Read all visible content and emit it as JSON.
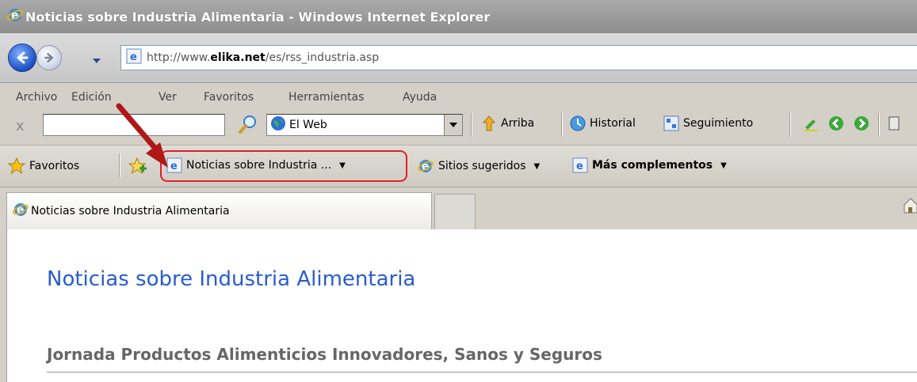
{
  "window": {
    "title": "Noticias sobre Industria Alimentaria - Windows Internet Explorer"
  },
  "address": {
    "url_prefix": "http://www.",
    "url_domain": "elika.net",
    "url_suffix": "/es/rss_industria.asp"
  },
  "menu": {
    "items": [
      "Archivo",
      "Edición",
      "Ver",
      "Favoritos",
      "Herramientas",
      "Ayuda"
    ]
  },
  "toolbar": {
    "close_label": "x",
    "search_value": "",
    "search_engine": "El Web",
    "arriba": "Arriba",
    "historial": "Historial",
    "seguimiento": "Seguimiento"
  },
  "favorites_bar": {
    "favoritos": "Favoritos",
    "feed_item": "Noticias sobre Industria ...",
    "sitios": "Sitios sugeridos",
    "complementos": "Más complementos"
  },
  "tabs": {
    "active": "Noticias sobre Industria Alimentaria"
  },
  "page": {
    "heading": "Noticias sobre Industria Alimentaria",
    "article": "Jornada Productos Alimenticios Innovadores, Sanos y Seguros"
  },
  "colors": {
    "heading": "#2a5bd0",
    "highlight": "#e0202a",
    "arrow": "#b01818"
  }
}
